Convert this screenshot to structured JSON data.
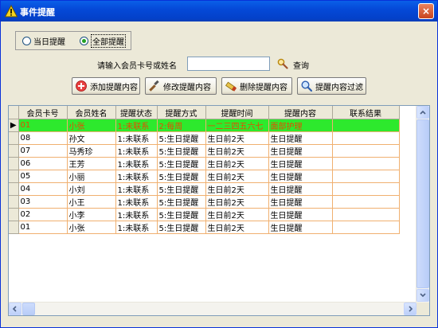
{
  "window": {
    "title": "事件提醒",
    "close_label": "×"
  },
  "filter": {
    "option_today": "当日提醒",
    "option_all": "全部提醒",
    "selected": "全部提醒"
  },
  "search": {
    "label": "请输入会员卡号或姓名",
    "value": "",
    "button_label": "查询"
  },
  "toolbar": {
    "add_label": "添加提醒内容",
    "edit_label": "修改提醒内容",
    "delete_label": "删除提醒内容",
    "filter_label": "提醒内容过滤"
  },
  "table": {
    "columns": [
      "会员卡号",
      "会员姓名",
      "提醒状态",
      "提醒方式",
      "提醒时间",
      "提醒内容",
      "联系结果"
    ],
    "rows": [
      [
        "01",
        "小张",
        "1:未联系",
        "2:每周",
        "一二三四五六七",
        "面部护理",
        ""
      ],
      [
        "08",
        "孙文",
        "1:未联系",
        "5:生日提醒",
        "生日前2天",
        "生日提醒",
        ""
      ],
      [
        "07",
        "马秀珍",
        "1:未联系",
        "5:生日提醒",
        "生日前2天",
        "生日提醒",
        ""
      ],
      [
        "06",
        "王芳",
        "1:未联系",
        "5:生日提醒",
        "生日前2天",
        "生日提醒",
        ""
      ],
      [
        "05",
        "小丽",
        "1:未联系",
        "5:生日提醒",
        "生日前2天",
        "生日提醒",
        ""
      ],
      [
        "04",
        "小刘",
        "1:未联系",
        "5:生日提醒",
        "生日前2天",
        "生日提醒",
        ""
      ],
      [
        "03",
        "小王",
        "1:未联系",
        "5:生日提醒",
        "生日前2天",
        "生日提醒",
        ""
      ],
      [
        "02",
        "小李",
        "1:未联系",
        "5:生日提醒",
        "生日前2天",
        "生日提醒",
        ""
      ],
      [
        "01",
        "小张",
        "1:未联系",
        "5:生日提醒",
        "生日前2天",
        "生日提醒",
        ""
      ]
    ]
  },
  "colors": {
    "selected_row_bg": "#2de92d",
    "selected_row_text": "#e54b00",
    "grid_line": "#f0b070",
    "title_bar": "#0549d8"
  },
  "icons": {
    "title": "warning-icon",
    "search": "search-icon",
    "add": "add-icon",
    "edit": "edit-icon",
    "delete": "delete-icon",
    "filter": "filter-icon"
  }
}
